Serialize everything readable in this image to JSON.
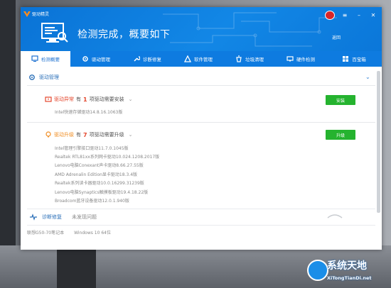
{
  "app": {
    "name": "驱动精灵",
    "headline": "检测完成，概要如下",
    "return_link": "返回"
  },
  "tabs": [
    {
      "label": "检测概要",
      "icon": "overview-icon",
      "active": true
    },
    {
      "label": "驱动管理",
      "icon": "gear-icon"
    },
    {
      "label": "诊断修复",
      "icon": "wrench-icon"
    },
    {
      "label": "软件管理",
      "icon": "software-icon"
    },
    {
      "label": "垃圾清理",
      "icon": "trash-icon"
    },
    {
      "label": "硬件检测",
      "icon": "hardware-icon"
    },
    {
      "label": "百宝箱",
      "icon": "toolbox-icon"
    }
  ],
  "driver_section": {
    "title": "驱动管理",
    "abnormal": {
      "title": "驱动异常",
      "prefix": "有",
      "count": "1",
      "suffix": "项驱动需要安装",
      "button": "安装",
      "items": [
        "Intel快速存储驱动14.8.16.1063版"
      ]
    },
    "upgrade": {
      "title": "驱动升级",
      "prefix": "有",
      "count": "7",
      "suffix": "项驱动需要升级",
      "button": "升级",
      "items": [
        "Intel管理引擎接口驱动11.7.0.1045版",
        "Realtek RTL81xx系列网卡驱动10.024.1208.2017版",
        "Lenovo电脑Conexant声卡驱动8.66.27.55版",
        "AMD Adrenalin Edition显卡驱动18.3.4版",
        "Realtek系列读卡器驱动10.0.16299.31239版",
        "Lenovo电脑Synaptics触摸板驱动19.4.18.22版",
        "Broadcom蓝牙设备驱动12.0.1.940版"
      ]
    }
  },
  "diagnosis": {
    "label": "诊断修复",
    "status": "未发现问题"
  },
  "system": {
    "model": "联想G50-70笔记本",
    "os": "Windows 10 64位"
  },
  "watermark": {
    "text": "系统天地",
    "url": "XiTongTianDi.net"
  },
  "colors": {
    "titlebar": "#0e7be0",
    "accent_green": "#25b32f",
    "alert_red": "#e4472d",
    "alert_orange": "#f08d22"
  }
}
